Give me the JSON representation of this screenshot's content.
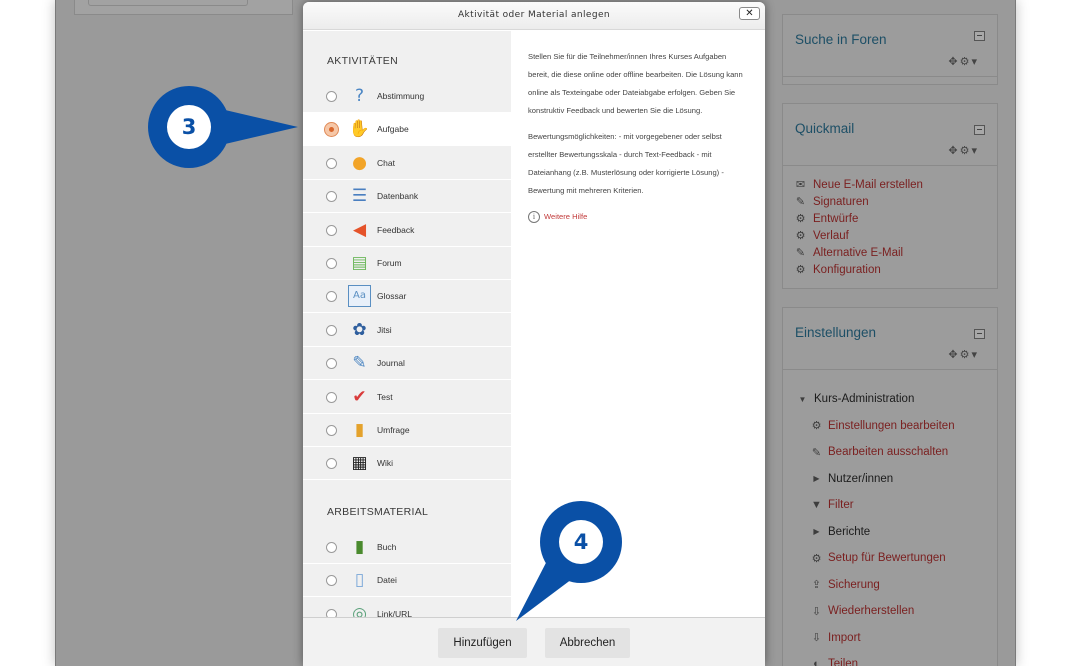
{
  "dialog": {
    "title": "Aktivität oder Material anlegen",
    "close_symbol": "✕",
    "activities_heading": "AKTIVITÄTEN",
    "materials_heading": "ARBEITSMATERIAL",
    "activities": [
      {
        "label": "Abstimmung",
        "icon": "question-icon",
        "glyph": "?",
        "color": "#4b86c4",
        "selected": false
      },
      {
        "label": "Aufgabe",
        "icon": "hand-document-icon",
        "glyph": "✋",
        "color": "#e2a879",
        "selected": true
      },
      {
        "label": "Chat",
        "icon": "chat-bubbles-icon",
        "glyph": "●",
        "color": "#f2a428",
        "selected": false
      },
      {
        "label": "Datenbank",
        "icon": "database-icon",
        "glyph": "☰",
        "color": "#4a7fc0",
        "selected": false
      },
      {
        "label": "Feedback",
        "icon": "megaphone-icon",
        "glyph": "◀",
        "color": "#e5532a",
        "selected": false
      },
      {
        "label": "Forum",
        "icon": "forum-bubbles-icon",
        "glyph": "▤",
        "color": "#6db85c",
        "selected": false
      },
      {
        "label": "Glossar",
        "icon": "glossary-book-icon",
        "glyph": "Aa",
        "color": "#5a8fc2",
        "selected": false
      },
      {
        "label": "Jitsi",
        "icon": "jitsi-icon",
        "glyph": "✿",
        "color": "#2f5f9e",
        "selected": false
      },
      {
        "label": "Journal",
        "icon": "journal-pencil-icon",
        "glyph": "✎",
        "color": "#4c86c2",
        "selected": false
      },
      {
        "label": "Test",
        "icon": "test-checkmark-icon",
        "glyph": "✔",
        "color": "#d93b3b",
        "selected": false
      },
      {
        "label": "Umfrage",
        "icon": "survey-barchart-icon",
        "glyph": "▮",
        "color": "#e4a22c",
        "selected": false
      },
      {
        "label": "Wiki",
        "icon": "wiki-icon",
        "glyph": "▦",
        "color": "#222222",
        "selected": false
      }
    ],
    "materials": [
      {
        "label": "Buch",
        "icon": "book-icon",
        "glyph": "▮",
        "color": "#4a8a2e",
        "selected": false
      },
      {
        "label": "Datei",
        "icon": "file-icon",
        "glyph": "▯",
        "color": "#7aa7d8",
        "selected": false
      },
      {
        "label": "Link/URL",
        "icon": "link-url-icon",
        "glyph": "◎",
        "color": "#5aa07a",
        "selected": false
      }
    ],
    "description": [
      "Stellen Sie für die Teilnehmer/innen Ihres Kurses Aufgaben bereit, die diese online oder offline bearbeiten. Die Lösung kann online als Texteingabe oder Dateiabgabe erfolgen. Geben Sie konstruktiv Feedback und bewerten Sie die Lösung.",
      "Bewertungsmöglichkeiten: - mit vorgegebener oder selbst erstellter Bewertungsskala - durch Text-Feedback - mit Dateianhang (z.B. Musterlösung oder korrigierte Lösung) - Bewertung mit mehreren Kriterien."
    ],
    "help_link": "Weitere Hilfe",
    "add_button": "Hinzufügen",
    "cancel_button": "Abbrechen"
  },
  "callouts": {
    "step3": "3",
    "step4": "4",
    "color": "#0a50a6"
  },
  "sidebar": {
    "forum_search": {
      "title": "Suche in Foren"
    },
    "quickmail": {
      "title": "Quickmail",
      "items": [
        {
          "label": "Neue E-Mail erstellen",
          "icon": "envelope-icon",
          "glyph": "✉"
        },
        {
          "label": "Signaturen",
          "icon": "pencil-icon",
          "glyph": "✎"
        },
        {
          "label": "Entwürfe",
          "icon": "gear-icon",
          "glyph": "⚙"
        },
        {
          "label": "Verlauf",
          "icon": "gear-icon",
          "glyph": "⚙"
        },
        {
          "label": "Alternative E-Mail",
          "icon": "pencil-icon",
          "glyph": "✎"
        },
        {
          "label": "Konfiguration",
          "icon": "gear-icon",
          "glyph": "⚙"
        }
      ]
    },
    "settings": {
      "title": "Einstellungen",
      "course_admin": "Kurs-Administration",
      "items": [
        {
          "label": "Einstellungen bearbeiten",
          "icon": "gear-icon",
          "glyph": "⚙",
          "link": true
        },
        {
          "label": "Bearbeiten ausschalten",
          "icon": "pencil-icon",
          "glyph": "✎",
          "link": true
        },
        {
          "label": "Nutzer/innen",
          "icon": "caret-right-icon",
          "glyph": "▶",
          "link": false
        },
        {
          "label": "Filter",
          "icon": "filter-icon",
          "glyph": "▼",
          "link": true
        },
        {
          "label": "Berichte",
          "icon": "caret-right-icon",
          "glyph": "▶",
          "link": false
        },
        {
          "label": "Setup für Bewertungen",
          "icon": "gear-icon",
          "glyph": "⚙",
          "link": true
        },
        {
          "label": "Sicherung",
          "icon": "upload-icon",
          "glyph": "⇪",
          "link": true
        },
        {
          "label": "Wiederherstellen",
          "icon": "download-icon",
          "glyph": "⇩",
          "link": true
        },
        {
          "label": "Import",
          "icon": "download-icon",
          "glyph": "⇩",
          "link": true
        },
        {
          "label": "Teilen",
          "icon": "share-icon",
          "glyph": "◐",
          "link": true
        }
      ]
    }
  }
}
